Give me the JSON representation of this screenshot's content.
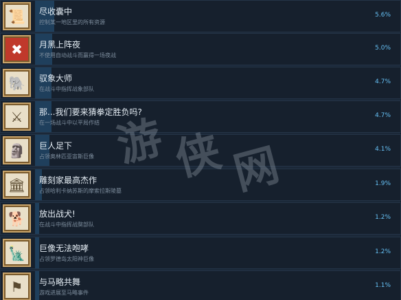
{
  "achievements": [
    {
      "title": "尽收囊中",
      "desc": "控制某一地区里的所有资源",
      "pct": "5.6%",
      "pct_value": 5.6,
      "icon": "scroll-icon"
    },
    {
      "title": "月黑上阵夜",
      "desc": "不使用自动战斗而赢得一场夜战",
      "pct": "5.0%",
      "pct_value": 5.0,
      "icon": "crossed-moon-icon"
    },
    {
      "title": "驭象大师",
      "desc": "在战斗中指挥战象部队",
      "pct": "4.7%",
      "pct_value": 4.7,
      "icon": "elephant-icon"
    },
    {
      "title": "那...我们要来猜拳定胜负吗?",
      "desc": "在一场战斗中以平局作结",
      "pct": "4.7%",
      "pct_value": 4.7,
      "icon": "crossed-swords-icon"
    },
    {
      "title": "巨人足下",
      "desc": "占领奥林匹亚宙斯巨像",
      "pct": "4.1%",
      "pct_value": 4.1,
      "icon": "statue-icon"
    },
    {
      "title": "雕刻家最高杰作",
      "desc": "占领哈利卡纳苏斯的摩索拉斯陵墓",
      "pct": "1.9%",
      "pct_value": 1.9,
      "icon": "temple-icon"
    },
    {
      "title": "放出战犬!",
      "desc": "在战斗中指挥战獒部队",
      "pct": "1.2%",
      "pct_value": 1.2,
      "icon": "war-dog-icon"
    },
    {
      "title": "巨像无法咆哮",
      "desc": "占领罗德岛太阳神巨像",
      "pct": "1.2%",
      "pct_value": 1.2,
      "icon": "colossus-icon"
    },
    {
      "title": "与马略共舞",
      "desc": "游戏进展至马略事件",
      "pct": "1.1%",
      "pct_value": 1.1,
      "icon": "marius-icon"
    }
  ],
  "colors": {
    "background": "#1b2838",
    "row": "#16202d",
    "progress": "#1f3f5c",
    "percent": "#66c0f4"
  },
  "watermark": {
    "text": "游侠网"
  }
}
